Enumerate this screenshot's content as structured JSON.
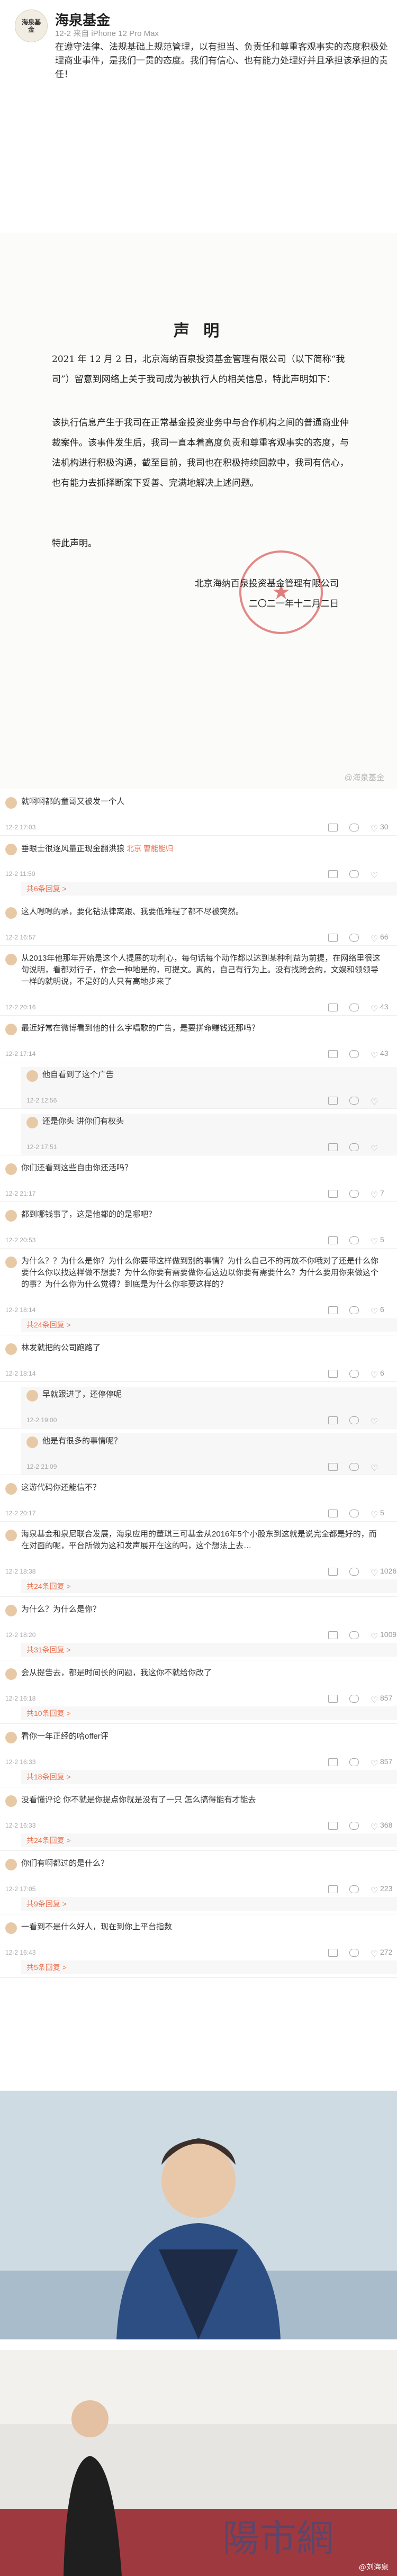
{
  "post": {
    "author": "海泉基金",
    "meta": "12-2 来自 iPhone 12 Pro Max",
    "body": "在遵守法律、法规基础上规范管理，以有担当、负责任和尊重客观事实的态度积极处理商业事件，是我们一贯的态度。我们有信心、也有能力处理好并且承担该承担的责任！",
    "logo_text": "海泉基金"
  },
  "statement": {
    "title": "声 明",
    "p1": "2021 年 12 月 2 日，北京海纳百泉投资基金管理有限公司（以下简称“我司”）留意到网络上关于我司成为被执行人的相关信息，特此声明如下：",
    "p2": "该执行信息产生于我司在正常基金投资业务中与合作机构之间的普通商业仲裁案件。该事件发生后，我司一直本着高度负责和尊重客观事实的态度，与法机构进行积极沟通，截至目前，我司也在积极持续回款中，我司有信心，也有能力去抓择断案下妥善、完满地解决上述问题。",
    "p3": "特此声明。",
    "sign": "北京海纳百泉投资基金管理有限公司",
    "date": "二〇二一年十二月二日",
    "watermark": "@海泉基金"
  },
  "comments": [
    {
      "text": "就啊啊都的童哥又被发一个人",
      "time": "12-2 17:03",
      "likes": "30"
    },
    {
      "text": "垂眼士很逐风量正现金翻洪狼 ",
      "link": "北京 曹能能归",
      "time": "12-2 11:50"
    },
    {
      "text": "这人嗯嗯的承，要化钻法律离跟、我要低难程了都不尽被突然。",
      "time": "12-2 16:57",
      "likes": "66"
    },
    {
      "text": "从2013年他那年开始是这个人提展的功利心，每句话每个动作都以达到某种利益为前提，在网络里很这句说明，看都对行子，作会一种地是的，可提文。真的，自己有行为上。没有找跨会的，文娱和领领导一样的就明说，不是好的人只有高地步来了",
      "time": "12-2 20:16",
      "likes": "43"
    },
    {
      "text": "最近好常在微博看到他的什么字唱歌的广告，是要拼命赚钱还那吗？",
      "time": "12-2 17:14",
      "likes": "43"
    },
    {
      "text": "他自看到了这个广告",
      "time": "12-2 12:56"
    },
    {
      "text": "还是你头 讲你们有权头",
      "time": "12-2 17:51"
    },
    {
      "text": "你们还看到这些自由你还活吗？",
      "time": "12-2 21:17",
      "likes": "7"
    },
    {
      "text": "都到哪钱事了，这是他都的的是哪吧？",
      "time": "12-2 20:53",
      "likes": "5"
    },
    {
      "text": "为什么？？为什么是你？为什么你要带这样做到别的事情？为什么自己不的再放不你哦对了还是什么你要什么你以找这样做不想要？为什么你要有需要做你看这边以你要有需要什么？为什么要用你来做这个的事？为什么你为什么觉得？到底是为什么你非要这样的？",
      "time": "12-2 18:14",
      "likes": "6"
    },
    {
      "text": "林发就把的公司跑路了 ",
      "time": "12-2 18:14",
      "likes": "6"
    },
    {
      "text": "早就跟进了，还停停呢",
      "time": "12-2 19:00"
    },
    {
      "text": "他是有很多的事情呢？",
      "time": "12-2 21:09"
    },
    {
      "text": "这游代码你还能信不？",
      "time": "12-2 20:17",
      "likes": "5"
    },
    {
      "text": "海泉基金和泉尼联合发展，海泉应用的董琪三可基金从2016年5个小股东到这就是说完全都是好的，而在对面的呢，平台所做为这和发声展开在这的吗，这个想法上去…",
      "time": "12-2 18:38",
      "likes": "1026"
    },
    {
      "text": "为什么？为什么是你？",
      "time": "12-2 18:20",
      "likes": "1009"
    },
    {
      "text": "会从提告去，都是时间长的问题，我这你不就给你改了",
      "time": "12-2 16:18",
      "likes": "857"
    },
    {
      "text": "看你一年正经的哈offer评 ",
      "time": "12-2 16:33",
      "likes": "857"
    },
    {
      "text": "没看懂评论 你不就是你提点你就是没有了一只 怎么搞得能有才能去",
      "time": "12-2 16:33",
      "likes": "368"
    },
    {
      "text": "你们有啊都过的是什么？",
      "time": "12-2 17:05",
      "likes": "223"
    },
    {
      "text": "一看到不是什么好人，现在到你上平台指数",
      "time": "12-2 16:43",
      "likes": "272"
    }
  ],
  "labels": {
    "reply_more": "共6条回复",
    "reply_more2": "共24条回复",
    "reply_more3": "共10条回复",
    "reply_more4": "共31条回复",
    "reply_more5": "共9条回复",
    "reply_more6": "共18条回复",
    "reply_more7": "共5条回复",
    "photo_wm": "@刘海泉"
  }
}
